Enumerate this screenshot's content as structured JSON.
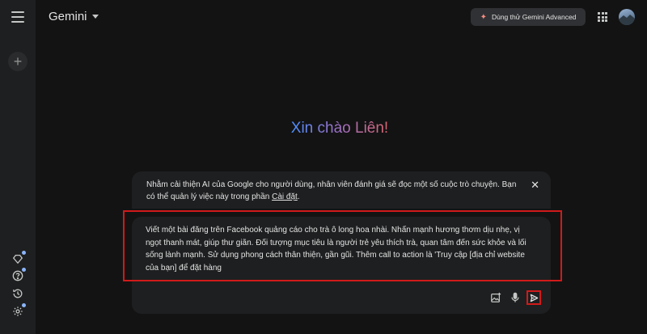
{
  "header": {
    "app_title": "Gemini",
    "advanced_button": "Dùng thử Gemini Advanced"
  },
  "greeting": "Xin chào Liên!",
  "notice": {
    "text": "Nhằm cải thiện AI của Google cho người dùng, nhân viên đánh giá sẽ đọc một số cuộc trò chuyện. Bạn có thể quản lý việc này trong phần ",
    "link": "Cài đặt",
    "end": ".",
    "close": "✕"
  },
  "prompt": {
    "value": "Viết một bài đăng trên Facebook quảng cáo cho trà ô long hoa nhài. Nhấn mạnh hương thơm dịu nhẹ, vị ngọt thanh mát, giúp thư giãn. Đối tượng mục tiêu là người trẻ yêu thích trà, quan tâm đến sức khỏe và lối sống lành mạnh. Sử dụng phong cách thân thiện, gần gũi. Thêm call to action là 'Truy cập [địa chỉ website của bạn] để đặt hàng"
  },
  "rail": {
    "new_chat": "+"
  },
  "icons": {
    "menu": "menu-icon",
    "new_chat": "plus-icon",
    "gems": "gem-icon",
    "help": "help-icon",
    "activity": "history-icon",
    "settings": "gear-icon",
    "apps": "apps-grid-icon",
    "image_upload": "image-upload-icon",
    "mic": "mic-icon",
    "send": "send-icon"
  },
  "colors": {
    "background": "#131314",
    "surface": "#1e1f20",
    "highlight": "#d11a1a",
    "gradient_start": "#4b90ff",
    "gradient_end": "#d96570"
  }
}
